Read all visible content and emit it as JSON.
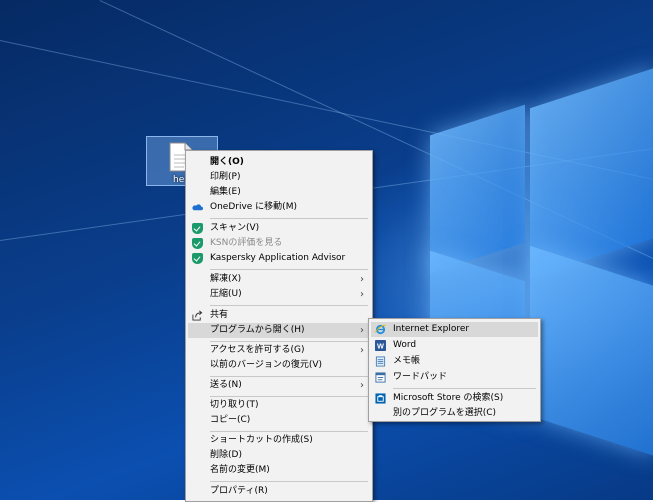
{
  "desktop": {
    "file_label": "he"
  },
  "context_menu": {
    "items": [
      {
        "label": "開く(O)",
        "bold": true
      },
      {
        "label": "印刷(P)"
      },
      {
        "label": "編集(E)"
      },
      {
        "label": "OneDrive に移動(M)",
        "icon": "onedrive-cloud-icon"
      },
      {
        "label": "スキャン(V)",
        "icon": "kaspersky-shield-icon"
      },
      {
        "label": "KSNの評価を見る",
        "icon": "kaspersky-shield-icon",
        "disabled": true
      },
      {
        "label": "Kaspersky Application Advisor",
        "icon": "kaspersky-shield-icon"
      },
      {
        "label": "解凍(X)",
        "submenu": true
      },
      {
        "label": "圧縮(U)",
        "submenu": true
      },
      {
        "label": "共有",
        "icon": "share-icon"
      },
      {
        "label": "プログラムから開く(H)",
        "submenu": true,
        "highlighted": true
      },
      {
        "label": "アクセスを許可する(G)",
        "submenu": true
      },
      {
        "label": "以前のバージョンの復元(V)"
      },
      {
        "label": "送る(N)",
        "submenu": true
      },
      {
        "label": "切り取り(T)"
      },
      {
        "label": "コピー(C)"
      },
      {
        "label": "ショートカットの作成(S)"
      },
      {
        "label": "削除(D)"
      },
      {
        "label": "名前の変更(M)"
      },
      {
        "label": "プロパティ(R)"
      }
    ]
  },
  "open_with_submenu": {
    "items": [
      {
        "label": "Internet Explorer",
        "icon": "internet-explorer-icon",
        "highlighted": true
      },
      {
        "label": "Word",
        "icon": "word-icon"
      },
      {
        "label": "メモ帳",
        "icon": "notepad-icon"
      },
      {
        "label": "ワードパッド",
        "icon": "wordpad-icon"
      },
      {
        "label": "Microsoft Store の検索(S)",
        "icon": "store-icon"
      },
      {
        "label": "別のプログラムを選択(C)"
      }
    ]
  },
  "colors": {
    "menu_bg": "#f2f2f2",
    "highlight": "#d8d8d8",
    "kaspersky_green": "#1a9a6a",
    "onedrive_blue": "#1e6fd0",
    "word_blue": "#2b579a"
  }
}
